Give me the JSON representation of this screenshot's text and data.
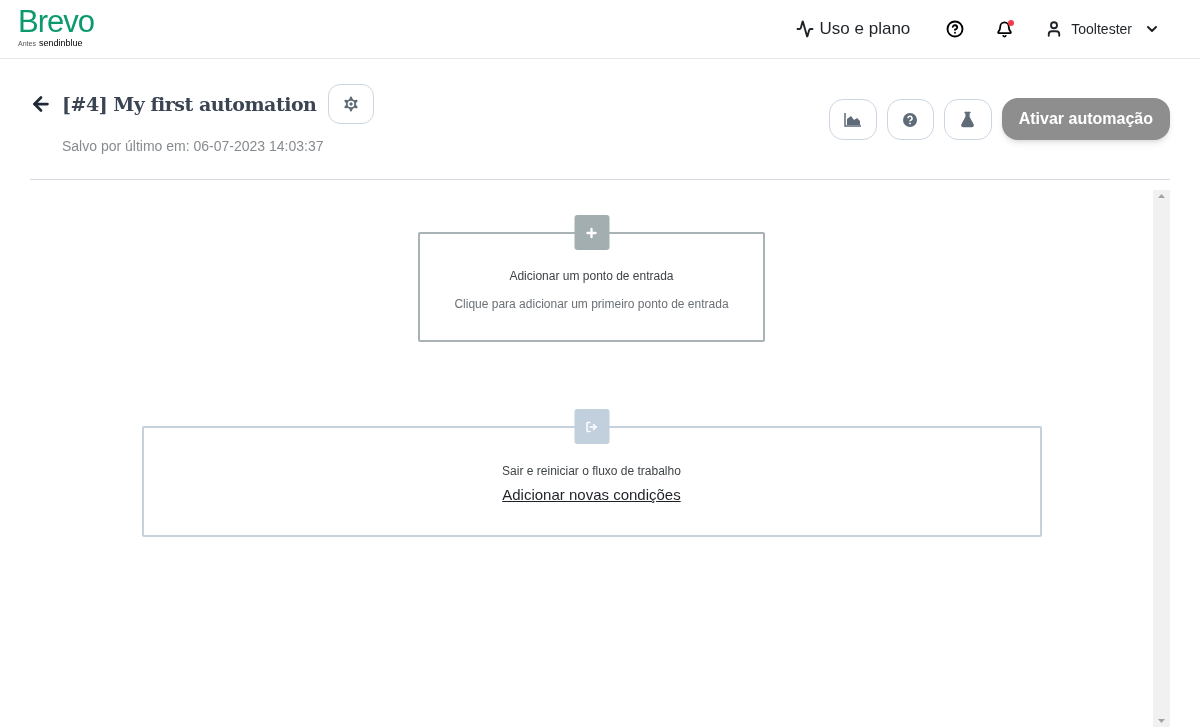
{
  "brand": {
    "logo": "Brevo",
    "tagline_prefix": "Antes",
    "tagline_name": "sendinblue"
  },
  "topbar": {
    "usage_link": "Uso e plano",
    "notifications": {
      "unread": true
    },
    "user": {
      "name": "Tooltester"
    }
  },
  "automation": {
    "title": "[#4] My first automation",
    "saved": "Salvo por último em: 06-07-2023 14:03:37",
    "activate_button": {
      "label": "Ativar automação",
      "disabled": true
    }
  },
  "canvas": {
    "nodes": [
      {
        "kind": "entry",
        "title": "Adicionar um ponto de entrada",
        "text": "Clique para adicionar um primeiro ponto de entrada"
      },
      {
        "kind": "exit",
        "title": "Sair e reiniciar o fluxo de trabalho",
        "link": "Adicionar novas condições"
      }
    ]
  }
}
